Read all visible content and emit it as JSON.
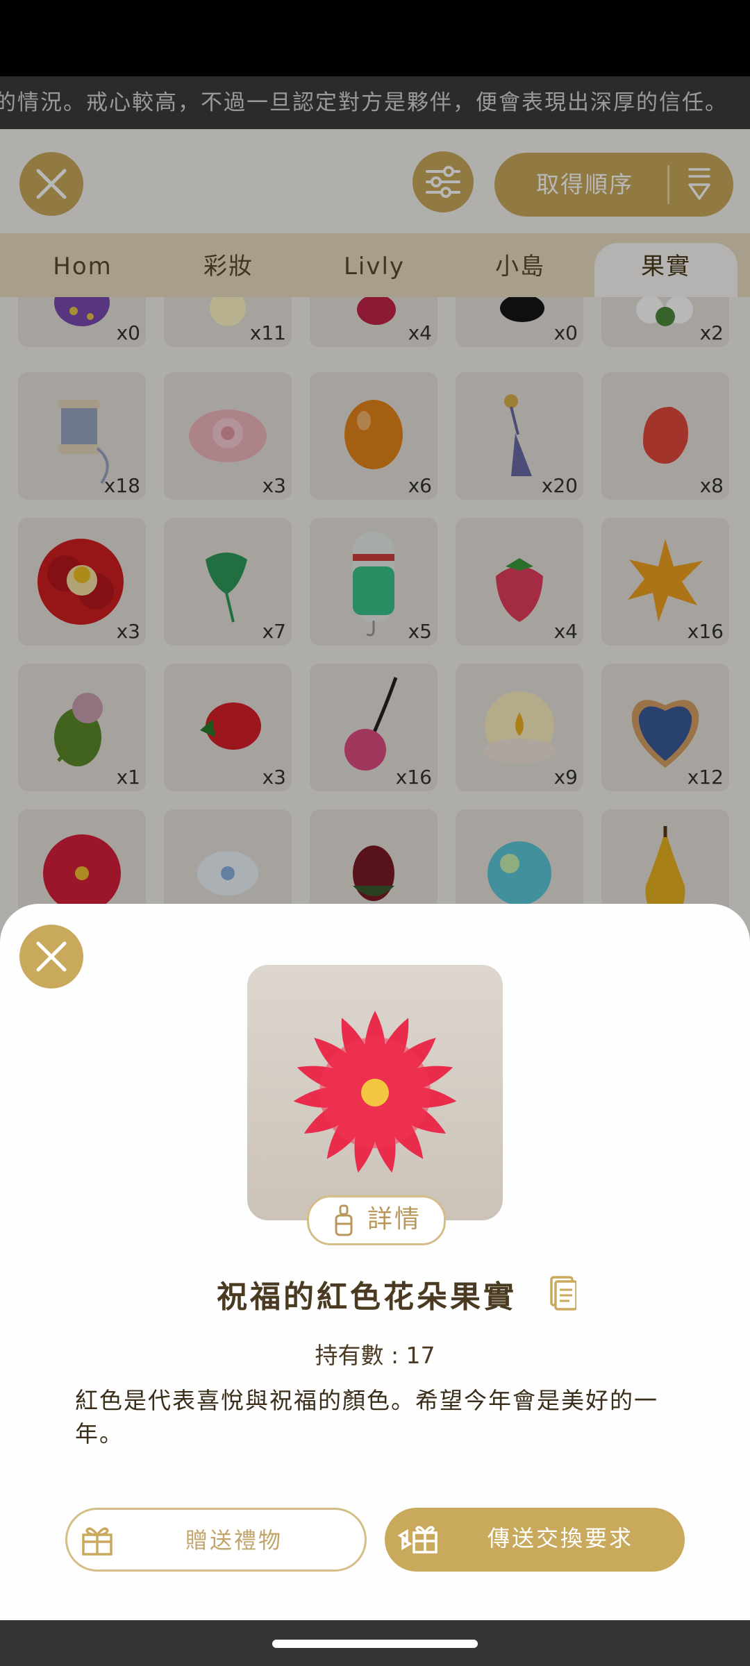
{
  "marquee": {
    "text": "的情況。戒心較高，不過一旦認定對方是夥伴，便會表現出深厚的信任。"
  },
  "header": {
    "close_icon": "close-icon",
    "filter_icon": "sliders-icon",
    "sort_label": "取得順序",
    "sort_icon": "sort-funnel-icon"
  },
  "tabs": [
    {
      "label": "Hom"
    },
    {
      "label": "彩妝"
    },
    {
      "label": "Livly"
    },
    {
      "label": "小島"
    },
    {
      "label": "果實",
      "active": true
    }
  ],
  "grid": {
    "rows": [
      [
        "x0",
        "x11",
        "x4",
        "x0",
        "x2"
      ],
      [
        "x18",
        "x3",
        "x6",
        "x20",
        "x8"
      ],
      [
        "x3",
        "x7",
        "x5",
        "x4",
        "x16"
      ],
      [
        "x1",
        "x3",
        "x16",
        "x9",
        "x12"
      ],
      [
        "",
        "",
        "",
        "",
        ""
      ]
    ],
    "icons": [
      [
        "egg-purple-icon",
        "glow-icon",
        "red-fruit-icon",
        "black-fruit-icon",
        "white-flower-icon"
      ],
      [
        "thread-spool-icon",
        "pink-rose-icon",
        "orange-egg-icon",
        "tassel-icon",
        "tulip-icon"
      ],
      [
        "camellia-icon",
        "green-leaf-icon",
        "bottle-icon",
        "strawberry-pink-icon",
        "maple-leaf-icon"
      ],
      [
        "poppy-pod-icon",
        "strawberry-icon",
        "cherry-icon",
        "candle-icon",
        "heart-cookie-icon"
      ],
      [
        "red-flower-icon",
        "white-lily-icon",
        "rosebud-icon",
        "bubble-icon",
        "pear-icon"
      ]
    ]
  },
  "sheet": {
    "close_icon": "close-icon",
    "item_icon": "red-flower-icon",
    "details_label": "詳情",
    "item_name": "祝福的紅色花朵果實",
    "count_label": "持有數 : 17",
    "description": "紅色是代表喜悅與祝福的顏色。希望今年會是美好的一年。",
    "gift_label": "贈送禮物",
    "trade_label": "傳送交換要求"
  },
  "colors": {
    "accent": "#c9a95c",
    "tab_bar": "#e9dcc2",
    "sheet_bg": "#fefefe"
  }
}
